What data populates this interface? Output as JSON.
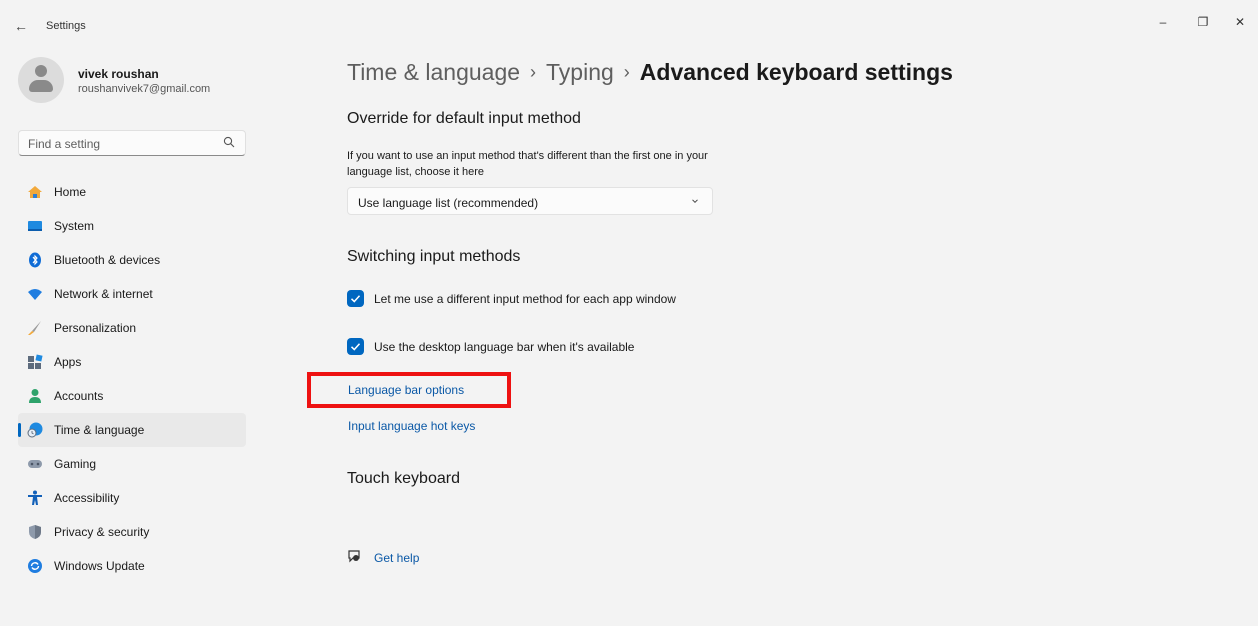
{
  "window": {
    "title": "Settings",
    "minimize_glyph": "–",
    "maximize_glyph": "❐",
    "close_glyph": "✕",
    "back_glyph": "←"
  },
  "profile": {
    "name": "vivek roushan",
    "email": "roushanvivek7@gmail.com"
  },
  "search": {
    "placeholder": "Find a setting",
    "icon": "search-icon"
  },
  "sidebar": {
    "items": [
      {
        "label": "Home",
        "icon": "home-icon",
        "active": false
      },
      {
        "label": "System",
        "icon": "system-icon",
        "active": false
      },
      {
        "label": "Bluetooth & devices",
        "icon": "bluetooth-icon",
        "active": false
      },
      {
        "label": "Network & internet",
        "icon": "wifi-icon",
        "active": false
      },
      {
        "label": "Personalization",
        "icon": "brush-icon",
        "active": false
      },
      {
        "label": "Apps",
        "icon": "apps-icon",
        "active": false
      },
      {
        "label": "Accounts",
        "icon": "person-icon",
        "active": false
      },
      {
        "label": "Time & language",
        "icon": "globe-clock-icon",
        "active": true
      },
      {
        "label": "Gaming",
        "icon": "gamepad-icon",
        "active": false
      },
      {
        "label": "Accessibility",
        "icon": "accessibility-icon",
        "active": false
      },
      {
        "label": "Privacy & security",
        "icon": "shield-icon",
        "active": false
      },
      {
        "label": "Windows Update",
        "icon": "update-icon",
        "active": false
      }
    ]
  },
  "breadcrumb": {
    "items": [
      "Time & language",
      "Typing",
      "Advanced keyboard settings"
    ],
    "separator": "›"
  },
  "override": {
    "heading": "Override for default input method",
    "description": "If you want to use an input method that's different than the first one in your language list, choose it here",
    "dropdown_value": "Use language list (recommended)"
  },
  "switching": {
    "heading": "Switching input methods",
    "option1": {
      "label": "Let me use a different input method for each app window",
      "checked": true
    },
    "option2": {
      "label": "Use the desktop language bar when it's available",
      "checked": true
    },
    "link1": "Language bar options",
    "link2": "Input language hot keys"
  },
  "touch": {
    "heading": "Touch keyboard"
  },
  "help": {
    "label": "Get help"
  },
  "colors": {
    "accent": "#0067c0",
    "link": "#0a58a6",
    "highlight": "#ee1111",
    "background": "#f3f3f3"
  }
}
